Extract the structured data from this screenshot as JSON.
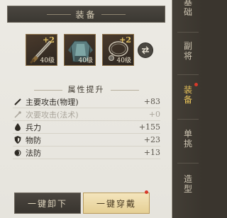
{
  "panel": {
    "title": "装备"
  },
  "equipment": [
    {
      "name": "weapon",
      "plus": "+2",
      "level": "40级",
      "icon": "sword-icon"
    },
    {
      "name": "armor",
      "plus": "+2",
      "level": "40级",
      "icon": "armor-icon"
    },
    {
      "name": "accessory",
      "plus": "+2",
      "level": "40级",
      "icon": "necklace-icon"
    }
  ],
  "swap_icon": "swap-icon",
  "attributes": {
    "title": "属性提升",
    "rows": [
      {
        "label": "主要攻击(物理)",
        "value": "+83",
        "icon": "sword-stat-icon",
        "dim": false
      },
      {
        "label": "次要攻击(法术)",
        "value": "+0",
        "icon": "staff-stat-icon",
        "dim": true
      },
      {
        "label": "兵力",
        "value": "+155",
        "icon": "drop-icon",
        "dim": false
      },
      {
        "label": "物防",
        "value": "+23",
        "icon": "shield-icon",
        "dim": false
      },
      {
        "label": "法防",
        "value": "+13",
        "icon": "magic-shield-icon",
        "dim": false
      }
    ]
  },
  "buttons": {
    "unequip": "一键卸下",
    "equip": "一键穿戴"
  },
  "nav": {
    "items": [
      {
        "label_1": "基",
        "label_2": "础",
        "active": false
      },
      {
        "label_1": "副",
        "label_2": "将",
        "active": false
      },
      {
        "label_1": "装",
        "label_2": "备",
        "active": true
      },
      {
        "label_1": "单",
        "label_2": "挑",
        "active": false
      },
      {
        "label_1": "造",
        "label_2": "型",
        "active": false
      }
    ]
  },
  "colors": {
    "accent": "#e9c45a",
    "notify": "#d83a2a",
    "panel_bg": "#eceae4",
    "nav_bg": "#3a352e"
  }
}
